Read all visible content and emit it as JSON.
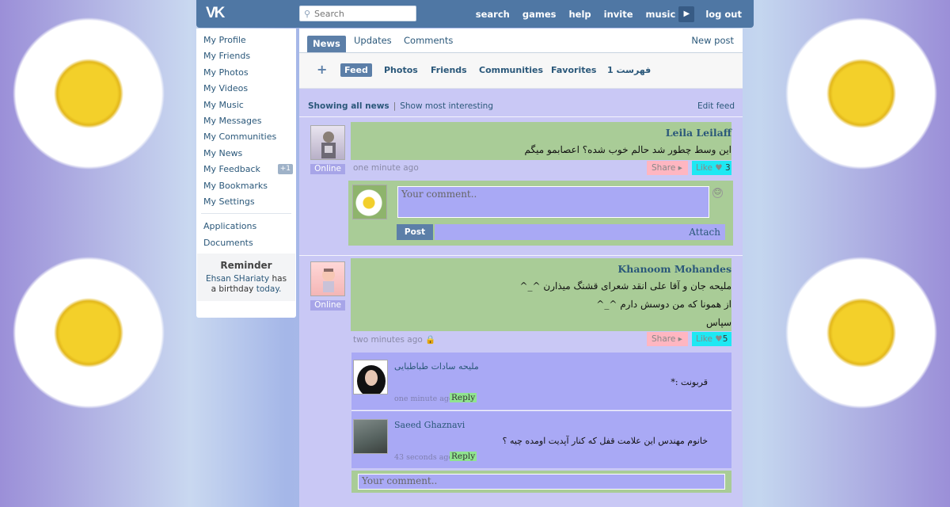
{
  "header": {
    "logo": "VK",
    "search_placeholder": "Search",
    "nav": [
      "search",
      "games",
      "help",
      "invite",
      "music",
      "log out"
    ]
  },
  "sidebar": {
    "items": [
      {
        "label": "My Profile"
      },
      {
        "label": "My Friends"
      },
      {
        "label": "My Photos"
      },
      {
        "label": "My Videos"
      },
      {
        "label": "My Music"
      },
      {
        "label": "My Messages"
      },
      {
        "label": "My Communities"
      },
      {
        "label": "My News"
      },
      {
        "label": "My Feedback",
        "badge": "+1"
      },
      {
        "label": "My Bookmarks"
      },
      {
        "label": "My Settings"
      }
    ],
    "extra_items": [
      {
        "label": "Applications"
      },
      {
        "label": "Documents"
      }
    ],
    "reminder": {
      "title": "Reminder",
      "name": "Ehsan SHariaty",
      "has": "has",
      "a_birthday": "a birthday",
      "today": "today."
    }
  },
  "main": {
    "tabs": [
      "News",
      "Updates",
      "Comments"
    ],
    "new_post": "New post",
    "subtabs": [
      "Feed",
      "Photos",
      "Friends",
      "Communities",
      "Favorites",
      "فهرست 1"
    ],
    "filter_active": "Showing all news",
    "filter_sep": "|",
    "filter_other": "Show most interesting",
    "edit_feed": "Edit feed"
  },
  "posts": [
    {
      "author": "Leila Leilaff",
      "status": "Online",
      "lines": [
        "این وسط چطور شد حالم خوب شده؟ اعصابمو میگم"
      ],
      "time": "one minute ago",
      "share": "Share",
      "like": "Like",
      "like_count": "3",
      "comment_placeholder": "Your comment..",
      "post_button": "Post",
      "attach": "Attach"
    },
    {
      "author": "Khanoom Mohandes",
      "status": "Online",
      "lines": [
        "ملیحه جان و آقا علی انقد شعرای قشنگ میذارن ^_^",
        "از همونا که من دوسش دارم ^_^",
        "سپاس"
      ],
      "time": "two minutes ago",
      "share": "Share",
      "like": "Like",
      "like_count": "5",
      "replies": [
        {
          "name": "ملیحه سادات طباطبایی",
          "text": "قربونت :*",
          "time": "one minute ago",
          "reply": "Reply"
        },
        {
          "name": "Saeed Ghaznavi",
          "text": "خانوم مهندس این علامت قفل که کنار آپدیت اومده چیه ؟",
          "time": "43 seconds ago",
          "reply": "Reply"
        }
      ],
      "comment_placeholder": "Your comment.."
    }
  ],
  "colors": {
    "header": "#4f77a4",
    "feed_bg": "#c9c8f5",
    "post_bg": "#a9cc97",
    "reply_bg": "#a9a9f5",
    "share_bg": "#ffb6c1",
    "like_bg": "#1ee8f3"
  }
}
